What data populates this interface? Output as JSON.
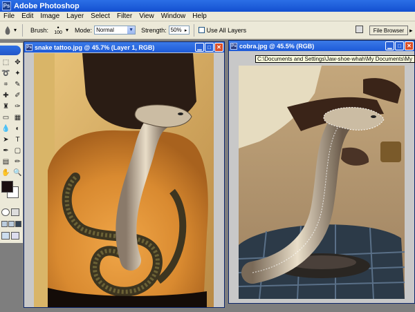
{
  "app": {
    "title": "Adobe Photoshop",
    "logo_text": "Ps"
  },
  "menu": [
    "File",
    "Edit",
    "Image",
    "Layer",
    "Select",
    "Filter",
    "View",
    "Window",
    "Help"
  ],
  "options": {
    "brush_label": "Brush:",
    "brush_size": "100",
    "mode_label": "Mode:",
    "mode_value": "Normal",
    "strength_label": "Strength:",
    "strength_value": "50%",
    "use_all_layers_label": "Use All Layers",
    "file_browser_label": "File Browser"
  },
  "windows": {
    "left": {
      "title": "snake tattoo.jpg @ 45.7% (Layer 1, RGB)"
    },
    "right": {
      "title": "cobra.jpg @ 45.5% (RGB)"
    }
  },
  "tooltip": {
    "text": "C:\\Documents and Settings\\Jaw-shoe-whah\\My Documents\\My Pictures"
  },
  "colors": {
    "titlebar": "#1d5ad8",
    "foreground_swatch": "#1a0f10",
    "background_swatch": "#ffffff",
    "close_button": "#d9502a"
  },
  "icons": [
    "smudge-tool-icon",
    "brush-preset-icon",
    "palette-well-icon",
    "minimize-icon",
    "maximize-icon",
    "close-icon"
  ]
}
